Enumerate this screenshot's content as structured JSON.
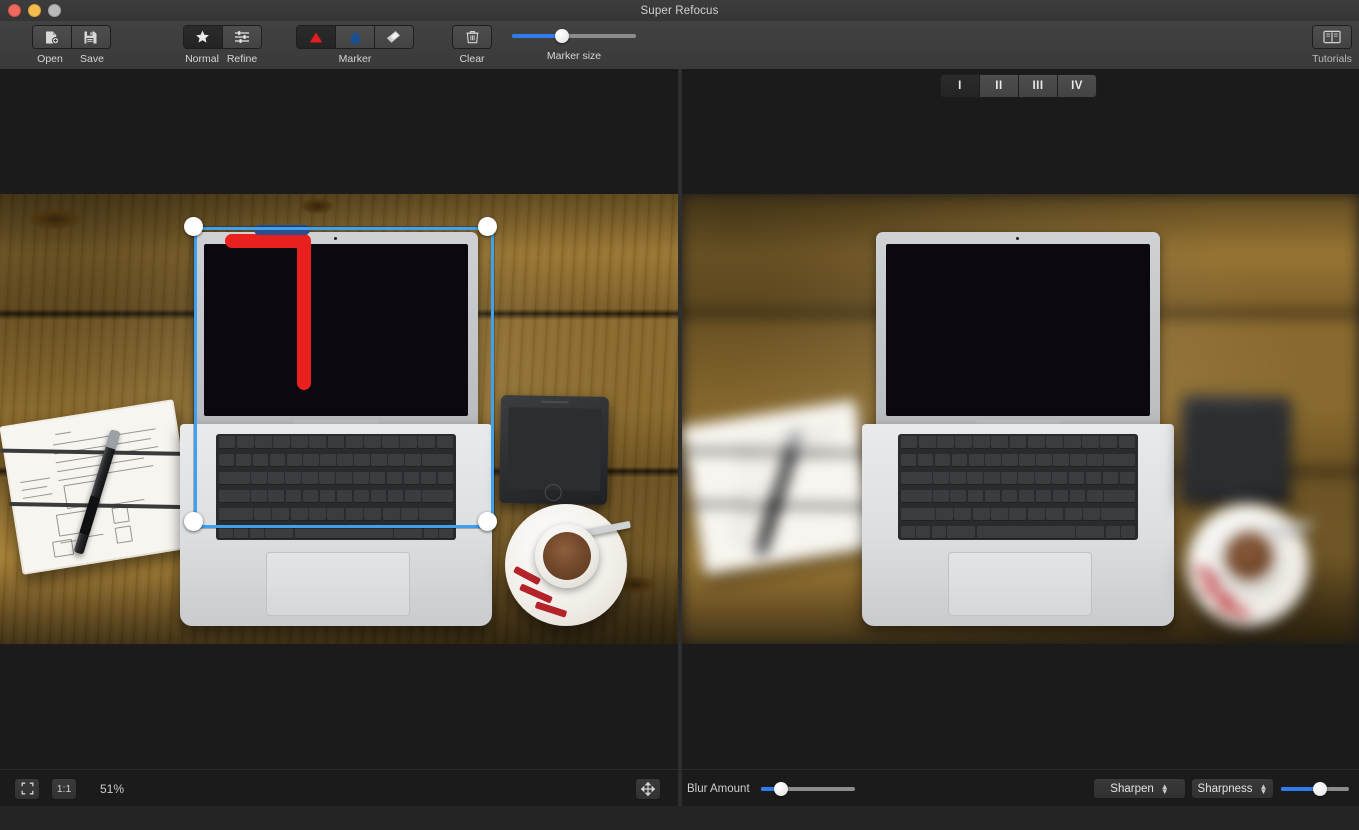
{
  "window": {
    "title": "Super Refocus",
    "traffic_lights": [
      "close-red",
      "minimize-yellow",
      "zoom-gray"
    ]
  },
  "toolbar": {
    "file_group": {
      "open_label": "Open",
      "save_label": "Save",
      "open_icon": "open-image-icon",
      "save_icon": "floppy-disk-save-icon"
    },
    "mode_group": {
      "normal_label": "Normal",
      "refine_label": "Refine",
      "normal_icon": "star-icon",
      "refine_icon": "sliders-icon",
      "selected": "Normal"
    },
    "marker_group": {
      "group_label": "Marker",
      "items": [
        {
          "name": "focus-marker",
          "icon": "red-triangle-icon",
          "selected": true
        },
        {
          "name": "blur-marker",
          "icon": "blue-droplet-icon",
          "selected": false
        },
        {
          "name": "eraser-marker",
          "icon": "eraser-icon",
          "selected": false
        }
      ]
    },
    "clear_group": {
      "label": "Clear",
      "icon": "trash-icon"
    },
    "marker_size": {
      "label": "Marker size",
      "value_percent": 40
    },
    "tutorials": {
      "label": "Tutorials",
      "icon": "book-icon"
    }
  },
  "quadrant_selector": {
    "options": [
      "I",
      "II",
      "III",
      "IV"
    ],
    "selected": "I"
  },
  "left_pane": {
    "image_alt": "Desk scene: MacBook Air, notebook with pen, smartphone and espresso cup on wooden table",
    "overlay": {
      "selection_name": "focus-plane-selection",
      "handles": 4,
      "strokes": [
        {
          "name": "red-focus-stroke",
          "color": "#e8211f"
        },
        {
          "name": "blue-blur-stroke",
          "color": "#2b4f8e"
        }
      ],
      "accent_color": "#3da0f0"
    }
  },
  "right_pane": {
    "image_alt": "Preview of the same desk scene with tilt-shift blur applied outside the focus plane"
  },
  "bottom_left": {
    "fit_button": "fit-to-window-icon",
    "actual_size_button": "1:1",
    "zoom_level": "51%",
    "pan_button": "pan-move-icon"
  },
  "bottom_right": {
    "blur_amount": {
      "label": "Blur Amount",
      "value_percent": 22
    },
    "effect_select": {
      "value": "Sharpen",
      "options": [
        "Sharpen"
      ]
    },
    "parameter_select": {
      "value": "Sharpness",
      "options": [
        "Sharpness"
      ]
    },
    "parameter_slider": {
      "value_percent": 58
    }
  },
  "colors": {
    "accent": "#2f7ced",
    "selection": "#3da0f0",
    "marker_red": "#e8211f",
    "marker_blue": "#2b4f8e",
    "toolbar_bg": "#3e3e3e",
    "canvas_bg": "#1b1b1b"
  }
}
